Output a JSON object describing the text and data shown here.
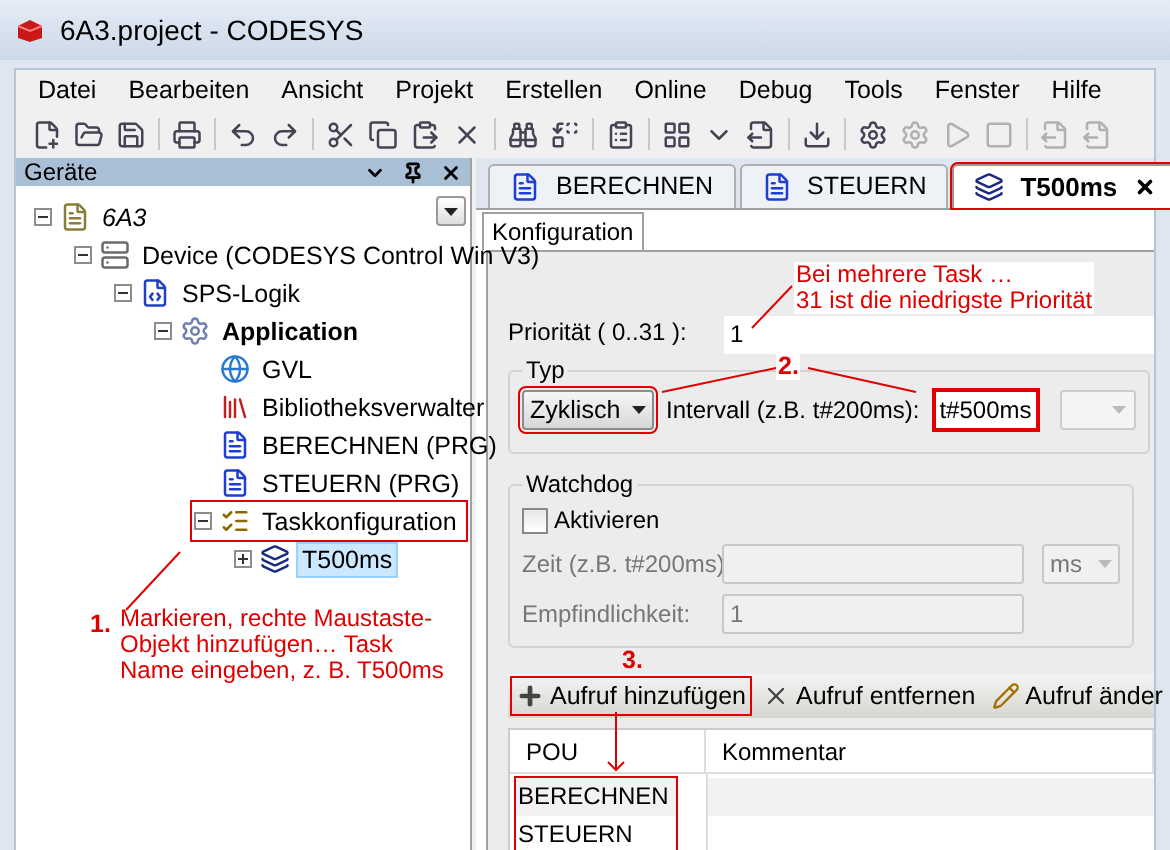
{
  "window": {
    "title": "6A3.project - CODESYS"
  },
  "menu": [
    "Datei",
    "Bearbeiten",
    "Ansicht",
    "Projekt",
    "Erstellen",
    "Online",
    "Debug",
    "Tools",
    "Fenster",
    "Hilfe"
  ],
  "devices_panel": {
    "title": "Geräte",
    "tree": [
      {
        "label": "6A3",
        "kind": "project",
        "expanded": true,
        "selected": false,
        "highlighted": false,
        "children": [
          {
            "label": "Device (CODESYS Control Win V3)",
            "kind": "device",
            "expanded": true,
            "selected": false,
            "highlighted": false,
            "children": [
              {
                "label": "SPS-Logik",
                "kind": "plc-logic",
                "expanded": true,
                "selected": false,
                "highlighted": false,
                "children": [
                  {
                    "label": "Application",
                    "kind": "application",
                    "expanded": true,
                    "selected": false,
                    "highlighted": false,
                    "children": [
                      {
                        "label": "GVL",
                        "kind": "gvl",
                        "selected": false,
                        "highlighted": false
                      },
                      {
                        "label": "Bibliotheksverwalter",
                        "kind": "library",
                        "selected": false,
                        "highlighted": false
                      },
                      {
                        "label": "BERECHNEN (PRG)",
                        "kind": "program",
                        "selected": false,
                        "highlighted": false
                      },
                      {
                        "label": "STEUERN (PRG)",
                        "kind": "program",
                        "selected": false,
                        "highlighted": false
                      },
                      {
                        "label": "Taskkonfiguration",
                        "kind": "task-config",
                        "expanded": true,
                        "selected": false,
                        "highlighted": true,
                        "children": [
                          {
                            "label": "T500ms",
                            "kind": "task",
                            "expanded": false,
                            "selected": true,
                            "highlighted": false
                          }
                        ]
                      }
                    ]
                  }
                ]
              }
            ]
          }
        ]
      }
    ]
  },
  "editor_tabs": [
    {
      "label": "BERECHNEN",
      "kind": "program",
      "selected": false,
      "highlighted": false
    },
    {
      "label": "STEUERN",
      "kind": "program",
      "selected": false,
      "highlighted": false
    },
    {
      "label": "T500ms",
      "kind": "task",
      "selected": true,
      "highlighted": true
    }
  ],
  "sub_tab": {
    "label": "Konfiguration",
    "selected": true
  },
  "priority": {
    "label": "Priorität ( 0..31 ):",
    "value": "1"
  },
  "type_group": {
    "title": "Typ",
    "type_value": "Zyklisch",
    "type_highlighted": true,
    "interval_label": "Intervall (z.B. t#200ms):",
    "interval_value": "t#500ms",
    "interval_highlighted": true
  },
  "watchdog": {
    "title": "Watchdog",
    "activate_label": "Aktivieren",
    "checked": false,
    "time_label": "Zeit (z.B. t#200ms)",
    "time_unit": "ms",
    "sensitivity_label": "Empfindlichkeit:",
    "sensitivity_value": "1"
  },
  "call_toolbar": [
    {
      "label": "Aufruf hinzufügen",
      "kind": "add",
      "highlighted": true
    },
    {
      "label": "Aufruf entfernen",
      "kind": "remove",
      "highlighted": false
    },
    {
      "label": "Aufruf änder",
      "kind": "edit",
      "highlighted": false
    }
  ],
  "table": {
    "columns": [
      "POU",
      "Kommentar"
    ],
    "highlighted": true,
    "rows": [
      {
        "pou": "BERECHNEN",
        "selected": true
      },
      {
        "pou": "STEUERN",
        "selected": false
      }
    ]
  },
  "annotations": {
    "step1_number": "1.",
    "step1_text": "Markieren, rechte Maustaste-\nObjekt hinzufügen… Task\nName eingeben, z. B. T500ms",
    "priority_note": "Bei mehrere Task …\n31 ist die niedrigste Priorität",
    "step2_number": "2.",
    "step3_number": "3."
  }
}
